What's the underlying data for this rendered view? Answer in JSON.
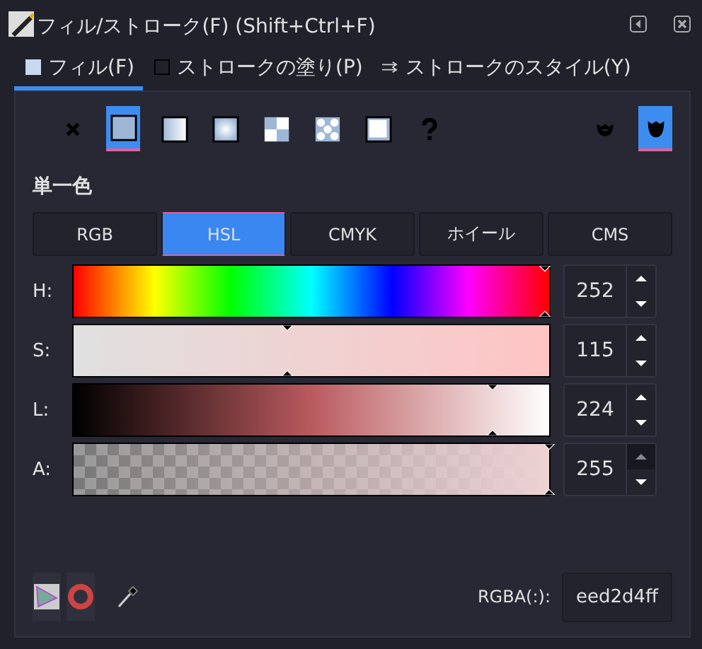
{
  "window": {
    "title": "フィル/ストローク(F) (Shift+Ctrl+F)"
  },
  "tabs": [
    {
      "label": "フィル(F)",
      "kind": "fill",
      "selected": true
    },
    {
      "label": "ストロークの塗り(P)",
      "kind": "stroke",
      "selected": false
    },
    {
      "label": "ストロークのスタイル(Y)",
      "kind": "style",
      "selected": false
    }
  ],
  "paint_types": [
    {
      "kind": "none",
      "selected": false
    },
    {
      "kind": "flat",
      "selected": true
    },
    {
      "kind": "linear",
      "selected": false
    },
    {
      "kind": "radial",
      "selected": false
    },
    {
      "kind": "mesh",
      "selected": false
    },
    {
      "kind": "pattern",
      "selected": false
    },
    {
      "kind": "swatch",
      "selected": false
    },
    {
      "kind": "unset",
      "selected": false
    }
  ],
  "fill_rules": [
    {
      "kind": "evenodd",
      "selected": false
    },
    {
      "kind": "nonzero",
      "selected": true
    }
  ],
  "paint_label": "単一色",
  "color_modes": [
    {
      "label": "RGB",
      "selected": false
    },
    {
      "label": "HSL",
      "selected": true
    },
    {
      "label": "CMYK",
      "selected": false
    },
    {
      "label": "ホイール",
      "selected": false
    },
    {
      "label": "CMS",
      "selected": false
    }
  ],
  "channels": [
    {
      "label": "H:",
      "kind": "hue",
      "level": 0.99,
      "value": "252",
      "up_disabled": false
    },
    {
      "label": "S:",
      "kind": "saturation",
      "level": 0.45,
      "value": "115",
      "up_disabled": false
    },
    {
      "label": "L:",
      "kind": "lightness",
      "level": 0.88,
      "value": "224",
      "up_disabled": false
    },
    {
      "label": "A:",
      "kind": "alpha",
      "level": 1,
      "value": "255",
      "up_disabled": true
    }
  ],
  "rgba": {
    "label": "RGBA(:):",
    "value": "eed2d4ff"
  }
}
